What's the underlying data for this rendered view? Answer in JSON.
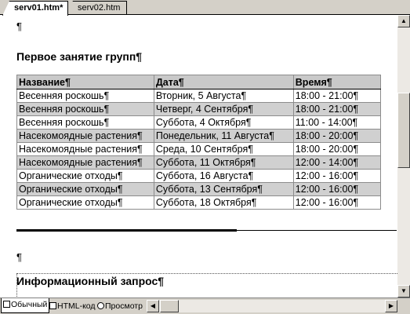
{
  "tabs": [
    {
      "label": "serv01.htm*",
      "active": true
    },
    {
      "label": "serv02.htm",
      "active": false
    }
  ],
  "document": {
    "pilcrow": "¶",
    "heading1": "Первое занятие групп¶",
    "table": {
      "headers": [
        "Название¶",
        "Дата¶",
        "Время¶"
      ],
      "rows": [
        {
          "name": "Весенняя роскошь¶",
          "date": "Вторник, 5 Августа¶",
          "time": "18:00 - 21:00¶",
          "shaded": false
        },
        {
          "name": "Весенняя роскошь¶",
          "date": "Четверг, 4 Сентября¶",
          "time": "18:00 - 21:00¶",
          "shaded": true
        },
        {
          "name": "Весенняя роскошь¶",
          "date": "Суббота, 4 Октября¶",
          "time": "11:00 - 14:00¶",
          "shaded": false
        },
        {
          "name": "Насекомоядные растения¶",
          "date": "Понедельник, 11 Августа¶",
          "time": "18:00 - 20:00¶",
          "shaded": true
        },
        {
          "name": "Насекомоядные растения¶",
          "date": "Среда, 10 Сентября¶",
          "time": "18:00 - 20:00¶",
          "shaded": false
        },
        {
          "name": "Насекомоядные растения¶",
          "date": "Суббота, 11 Октября¶",
          "time": "12:00 - 14:00¶",
          "shaded": true
        },
        {
          "name": "Органические отходы¶",
          "date": "Суббота, 16 Августа¶",
          "time": "12:00 - 16:00¶",
          "shaded": false
        },
        {
          "name": "Органические отходы¶",
          "date": "Суббота, 13 Сентября¶",
          "time": "12:00 - 16:00¶",
          "shaded": true
        },
        {
          "name": "Органические отходы¶",
          "date": "Суббота, 18 Октября¶",
          "time": "12:00 - 16:00¶",
          "shaded": false
        }
      ]
    },
    "pilcrow2": "¶",
    "heading2": "Информационный запрос¶"
  },
  "view_buttons": [
    {
      "label": "Обычный",
      "icon": "normal-view-icon",
      "active": true
    },
    {
      "label": "HTML-код",
      "icon": "html-code-icon",
      "active": false
    },
    {
      "label": "Просмотр",
      "icon": "preview-icon",
      "active": false
    }
  ],
  "scrollbar_glyphs": {
    "up": "▲",
    "down": "▼",
    "left": "◀",
    "right": "▶"
  }
}
